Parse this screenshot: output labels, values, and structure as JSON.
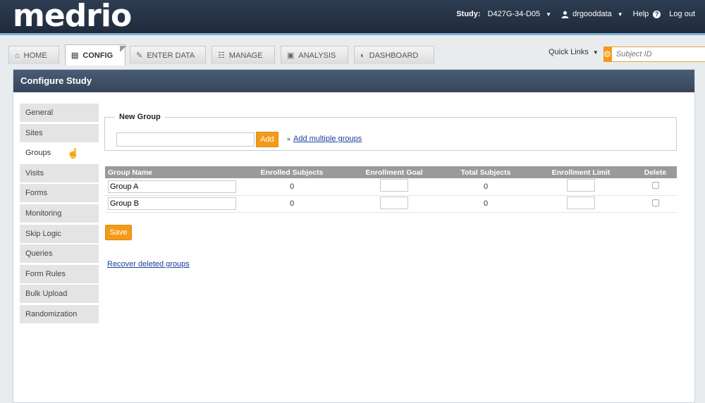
{
  "app": {
    "logo": "medrio"
  },
  "topbar": {
    "study_label": "Study:",
    "study_value": "D427G-34-D05",
    "user": "drgooddata",
    "help": "Help",
    "logout": "Log out"
  },
  "tabs": [
    {
      "label": "HOME",
      "icon": "home-icon"
    },
    {
      "label": "CONFIG",
      "icon": "config-icon"
    },
    {
      "label": "ENTER DATA",
      "icon": "edit-icon"
    },
    {
      "label": "MANAGE",
      "icon": "manage-icon"
    },
    {
      "label": "ANALYSIS",
      "icon": "analysis-icon"
    },
    {
      "label": "DASHBOARD",
      "icon": "dashboard-icon"
    }
  ],
  "quick_links": "Quick Links",
  "subject_search": {
    "placeholder": "Subject ID"
  },
  "panel": {
    "title": "Configure Study"
  },
  "sidebar": {
    "items": [
      {
        "label": "General"
      },
      {
        "label": "Sites"
      },
      {
        "label": "Groups"
      },
      {
        "label": "Visits"
      },
      {
        "label": "Forms"
      },
      {
        "label": "Monitoring"
      },
      {
        "label": "Skip Logic"
      },
      {
        "label": "Queries"
      },
      {
        "label": "Form Rules"
      },
      {
        "label": "Bulk Upload"
      },
      {
        "label": "Randomization"
      }
    ],
    "active": "Groups"
  },
  "new_group": {
    "legend": "New Group",
    "add_label": "Add",
    "add_multiple_label": "Add multiple groups"
  },
  "table": {
    "headers": [
      "Group Name",
      "Enrolled Subjects",
      "Enrollment Goal",
      "Total Subjects",
      "Enrollment Limit",
      "Delete"
    ],
    "rows": [
      {
        "name": "Group A",
        "enrolled": "0",
        "total": "0"
      },
      {
        "name": "Group B",
        "enrolled": "0",
        "total": "0"
      }
    ]
  },
  "save_label": "Save",
  "recover_label": "Recover deleted groups",
  "colors": {
    "accent": "#f39a1a",
    "header": "#1f2b3c",
    "panel_head": "#3f5068",
    "link": "#1a3fa0"
  }
}
